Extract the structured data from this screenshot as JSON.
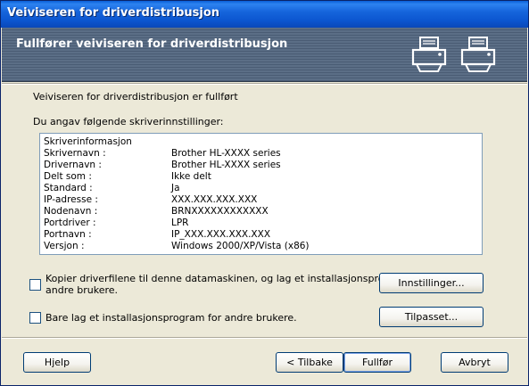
{
  "window": {
    "title": "Veiviseren for driverdistribusjon"
  },
  "banner": {
    "heading": "Fullfører veiviseren for driverdistribusjon",
    "icons": [
      "printer-icon",
      "printer-icon"
    ]
  },
  "main": {
    "status": "Veiviseren for driverdistribusjon er fullført",
    "settings_label": "Du angav følgende skriverinnstillinger:",
    "list": {
      "header": "Skriverinformasjon",
      "rows": [
        {
          "key": "Skrivernavn :",
          "value": "Brother HL-XXXX series"
        },
        {
          "key": "Drivernavn :",
          "value": "Brother HL-XXXX series"
        },
        {
          "key": "Delt som :",
          "value": "Ikke delt"
        },
        {
          "key": "Standard :",
          "value": "Ja"
        },
        {
          "key": "IP-adresse :",
          "value": "XXX.XXX.XXX.XXX"
        },
        {
          "key": "Nodenavn :",
          "value": "BRNXXXXXXXXXXXX"
        },
        {
          "key": "Portdriver :",
          "value": "LPR"
        },
        {
          "key": "Portnavn :",
          "value": "IP_XXX.XXX.XXX.XXX"
        },
        {
          "key": "Versjon :",
          "value": "Windows 2000/XP/Vista (x86)"
        }
      ]
    },
    "option1": {
      "label_line1": "Kopier driverfilene til denne datamaskinen, og lag et installasjonsprogram for",
      "label_line2": "andre brukere.",
      "checked": false
    },
    "option2": {
      "label": "Bare lag et installasjonsprogram for andre brukere.",
      "checked": false
    },
    "settings_button": "Innstillinger...",
    "custom_button": "Tilpasset..."
  },
  "footer": {
    "help": "Hjelp",
    "back": "< Tilbake",
    "finish": "Fullfør",
    "cancel": "Avbryt"
  }
}
